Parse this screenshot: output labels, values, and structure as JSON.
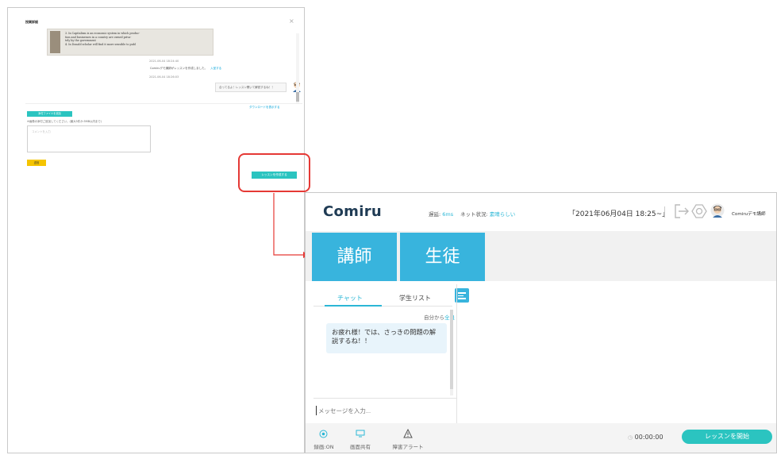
{
  "left_panel": {
    "title": "授業詳細",
    "close_icon": "×",
    "image_lines": [
      "3. In Capitalism is an economic system in which produc-",
      "    tion and businesses in a country are owned priva-",
      "    tely by the government",
      "4. In Donald scholar will find it more sensible to publ"
    ],
    "time1": "2021-06-04 18:24:40",
    "note": "Comiruデモ講師がレッスンを作成しました。",
    "note_link": "入室する",
    "time2": "2021-06-04 18:26:03",
    "bubble": "合ってるよ！レッスン開いて解説するね！！",
    "link2": "ダウンロードを表示する",
    "teal_btn": "添付ファイルを追加",
    "hint": "※画像の添付ご追加してください。(最大5件か:5MB以内まで)",
    "textarea_placeholder": "コメントを入力",
    "yellow_btn": "送信",
    "create_btn": "レッスンを作成する"
  },
  "right_panel": {
    "logo": "Comiru",
    "delay_label": "遅延:",
    "delay_value": "6ms",
    "net_label": "ネット状況:",
    "net_value": "素晴らしい",
    "date": "「2021年06月04日 18:25~」",
    "username": "Comiruデモ講師",
    "tiles": [
      "講師",
      "生徒"
    ],
    "tabs": [
      "チャット",
      "学生リスト"
    ],
    "from_prefix": "自分から",
    "from_all": "全員",
    "message": "お疲れ様！では、さっきの問題の解説するね！！",
    "input_placeholder": "メッセージを入力...",
    "tools": [
      {
        "label": "録画:ON",
        "icon": "record-icon"
      },
      {
        "label": "画面共有",
        "icon": "screen-share-icon"
      },
      {
        "label": "障害アラート",
        "icon": "warning-icon"
      }
    ],
    "timer": "00:00:00",
    "start_btn": "レッスンを開始"
  },
  "colors": {
    "teal": "#2bc4c0",
    "tile_blue": "#38b4dd",
    "highlight_red": "#e53935",
    "button_yellow": "#f5c400",
    "logo_navy": "#1f3b54"
  }
}
